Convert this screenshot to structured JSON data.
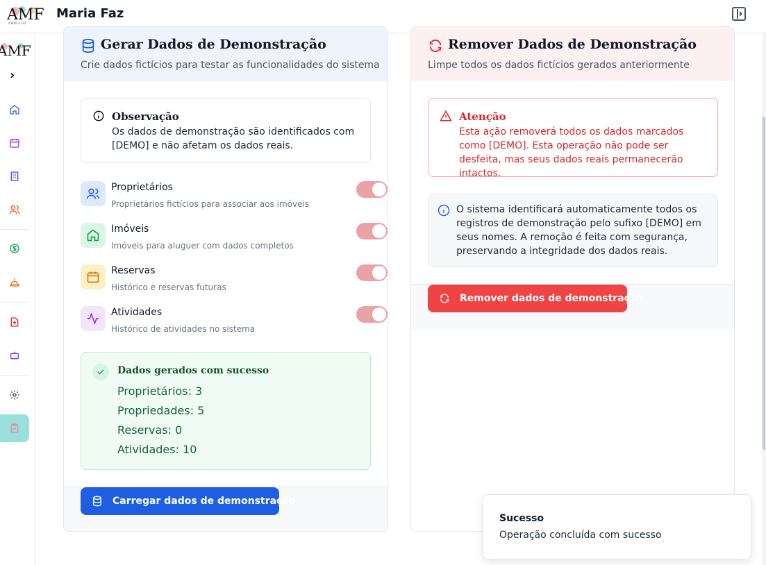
{
  "header": {
    "logo_text": "AMF",
    "logo_tagline": "A MAR A FAZ",
    "title": "Maria Faz"
  },
  "sidebar": {
    "logo_text": "AMF",
    "expand_glyph": "›",
    "items": [
      {
        "icon": "home-icon"
      },
      {
        "icon": "calendar-icon"
      },
      {
        "icon": "building-icon"
      },
      {
        "icon": "users-icon"
      },
      {
        "icon": "money-icon"
      },
      {
        "icon": "cleaning-icon"
      },
      {
        "icon": "upload-icon"
      },
      {
        "icon": "bot-icon"
      },
      {
        "icon": "settings-icon"
      },
      {
        "icon": "demo-data-icon",
        "active": true
      }
    ],
    "active_color": "#99e0dc"
  },
  "generate": {
    "title": "Gerar Dados de Demonstração",
    "subtitle": "Crie dados fictícios para testar as funcionalidades do sistema",
    "note_title": "Observação",
    "note_body": "Os dados de demonstração são identificados com [DEMO] e não afetam os dados reais.",
    "options": [
      {
        "title": "Proprietários",
        "subtitle": "Proprietários fictícios para associar aos imóveis",
        "icon": "users-icon",
        "enabled": true
      },
      {
        "title": "Imóveis",
        "subtitle": "Imóveis para aluguer com dados completos",
        "icon": "home-icon",
        "enabled": true
      },
      {
        "title": "Reservas",
        "subtitle": "Histórico e reservas futuras",
        "icon": "calendar-icon",
        "enabled": true
      },
      {
        "title": "Atividades",
        "subtitle": "Histórico de atividades no sistema",
        "icon": "activity-icon",
        "enabled": true
      }
    ],
    "success_title": "Dados gerados com sucesso",
    "success_lines": [
      "Proprietários: 3",
      "Propriedades: 5",
      "Reservas: 0",
      "Atividades: 10"
    ],
    "button_label": "Carregar dados de demonstração"
  },
  "remove": {
    "title": "Remover Dados de Demonstração",
    "subtitle": "Limpe todos os dados fictícios gerados anteriormente",
    "warning_title": "Atenção",
    "warning_body": "Esta ação removerá todos os dados marcados como [DEMO]. Esta operação não pode ser desfeita, mas seus dados reais permanecerão intactos.",
    "info_body": "O sistema identificará automaticamente todos os registros de demonstração pelo sufixo [DEMO] em seus nomes. A remoção é feita com segurança, preservando a integridade dos dados reais.",
    "button_label": "Remover dados de demonstração"
  },
  "toast": {
    "title": "Sucesso",
    "body": "Operação concluída com sucesso"
  },
  "colors": {
    "primary": "#1d5fe0",
    "danger": "#ef4444",
    "success": "#166534",
    "toggle_on": "#e9a2a8"
  }
}
